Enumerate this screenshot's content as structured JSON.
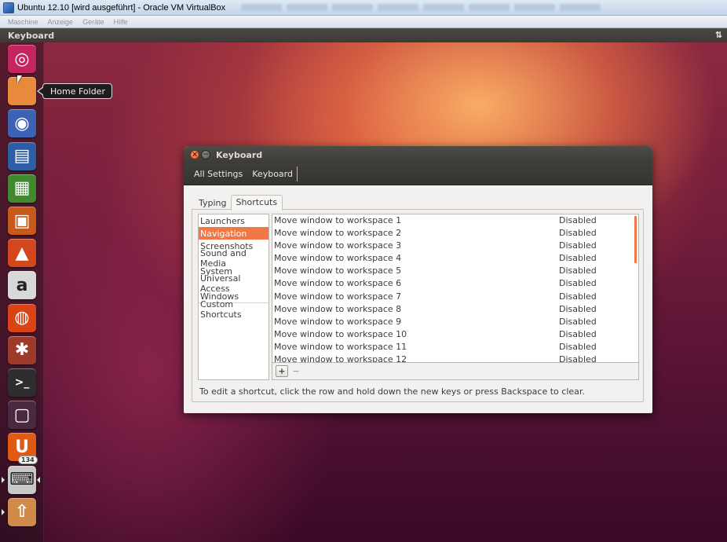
{
  "host": {
    "window_title": "Ubuntu 12.10 [wird ausgeführt] - Oracle VM VirtualBox",
    "menu": [
      "Maschine",
      "Anzeige",
      "Geräte",
      "Hilfe"
    ]
  },
  "top_panel": {
    "app_name": "Keyboard",
    "indicator": "⇅"
  },
  "launcher": {
    "tooltip": "Home Folder",
    "update_count": "134",
    "items": [
      {
        "name": "Dash Home",
        "icon": "ubuntu-logo-icon",
        "color": "#c5255f"
      },
      {
        "name": "Home Folder",
        "icon": "folder-icon",
        "color": "#e88a3c"
      },
      {
        "name": "Firefox",
        "icon": "firefox-icon",
        "color": "#3c62b4"
      },
      {
        "name": "LibreOffice Writer",
        "icon": "writer-icon",
        "color": "#2d5ea3"
      },
      {
        "name": "LibreOffice Calc",
        "icon": "calc-icon",
        "color": "#3f8a2c"
      },
      {
        "name": "LibreOffice Impress",
        "icon": "impress-icon",
        "color": "#c7591a"
      },
      {
        "name": "Ubuntu Software Center",
        "icon": "software-center-icon",
        "color": "#d4461c"
      },
      {
        "name": "Amazon",
        "icon": "amazon-icon",
        "color": "#d8d8d8"
      },
      {
        "name": "Ubuntu One",
        "icon": "ubuntu-one-icon",
        "color": "#d94315"
      },
      {
        "name": "System Settings",
        "icon": "settings-icon",
        "color": "#9e3a2a"
      },
      {
        "name": "Terminal",
        "icon": "terminal-icon",
        "color": "#2e2e2e"
      },
      {
        "name": "Workspace Switcher",
        "icon": "workspace-switcher-icon",
        "color": "#4a2a40"
      },
      {
        "name": "Ubuntu One Music",
        "icon": "ubuntu-one-music-icon",
        "color": "#e05a14"
      },
      {
        "name": "Keyboard",
        "icon": "keyboard-icon",
        "color": "#c8c8c8"
      },
      {
        "name": "Update Manager",
        "icon": "update-manager-icon",
        "color": "#d08a4a"
      }
    ]
  },
  "dialog": {
    "title": "Keyboard",
    "breadcrumb": [
      "All Settings",
      "Keyboard"
    ],
    "tabs": [
      "Typing",
      "Shortcuts"
    ],
    "active_tab": "Shortcuts",
    "categories": [
      "Launchers",
      "Navigation",
      "Screenshots",
      "Sound and Media",
      "System",
      "Universal Access",
      "Windows"
    ],
    "custom_category": "Custom Shortcuts",
    "selected_category": "Navigation",
    "shortcuts": [
      {
        "name": "Move window to workspace 1",
        "accel": "Disabled"
      },
      {
        "name": "Move window to workspace 2",
        "accel": "Disabled"
      },
      {
        "name": "Move window to workspace 3",
        "accel": "Disabled"
      },
      {
        "name": "Move window to workspace 4",
        "accel": "Disabled"
      },
      {
        "name": "Move window to workspace 5",
        "accel": "Disabled"
      },
      {
        "name": "Move window to workspace 6",
        "accel": "Disabled"
      },
      {
        "name": "Move window to workspace 7",
        "accel": "Disabled"
      },
      {
        "name": "Move window to workspace 8",
        "accel": "Disabled"
      },
      {
        "name": "Move window to workspace 9",
        "accel": "Disabled"
      },
      {
        "name": "Move window to workspace 10",
        "accel": "Disabled"
      },
      {
        "name": "Move window to workspace 11",
        "accel": "Disabled"
      },
      {
        "name": "Move window to workspace 12",
        "accel": "Disabled"
      }
    ],
    "add_label": "+",
    "remove_label": "−",
    "hint": "To edit a shortcut, click the row and hold down the new keys or press Backspace to clear."
  },
  "colors": {
    "ubuntu_orange": "#f07746",
    "panel_dark": "#3c3b37"
  }
}
